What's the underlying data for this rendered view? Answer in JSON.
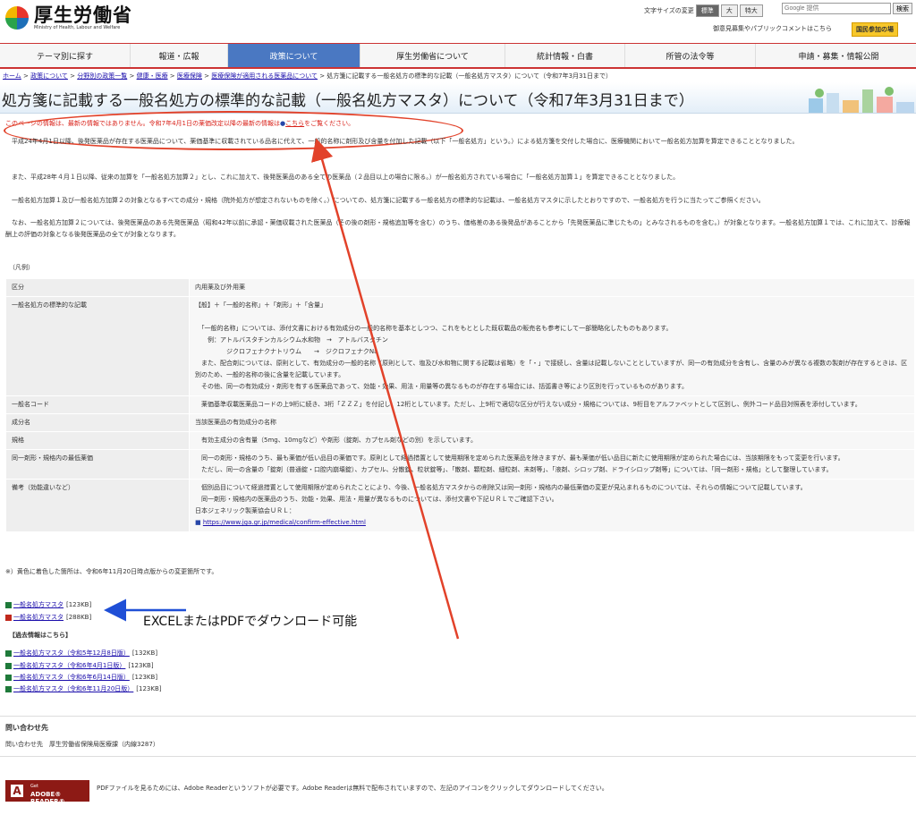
{
  "header": {
    "logo_jp": "厚生労働省",
    "logo_en": "Ministry of Health, Labour and Welfare",
    "fontsize_label": "文字サイズの変更",
    "fontsize_options": [
      "標準",
      "大",
      "特大"
    ],
    "search_placeholder": "Google 提供",
    "search_button": "検索",
    "pubcomment": "御意見募集やパブリックコメントはこちら",
    "kokumin": "国民参加の場"
  },
  "nav": [
    {
      "label": "テーマ別に探す",
      "active": false
    },
    {
      "label": "報道・広報",
      "active": false
    },
    {
      "label": "政策について",
      "active": true
    },
    {
      "label": "厚生労働省について",
      "active": false
    },
    {
      "label": "統計情報・白書",
      "active": false
    },
    {
      "label": "所管の法令等",
      "active": false
    },
    {
      "label": "申請・募集・情報公開",
      "active": false
    }
  ],
  "breadcrumb": {
    "links": [
      "ホーム",
      "政策について",
      "分野別の政策一覧",
      "健康・医療",
      "医療保険",
      "医療保険が適用される医薬品について"
    ],
    "sep": " > ",
    "current": "処方箋に記載する一般名処方の標準的な記載（一般名処方マスタ）について（令和7年3月31日まで）"
  },
  "title": "処方箋に記載する一般名処方の標準的な記載（一般名処方マスタ）について（令和7年3月31日まで）",
  "notice": {
    "text": "このページの情報は、最新の情報ではありません。令和7年4月1日の薬価改定以降の最新の情報は",
    "link": "こちら",
    "suffix": "をご覧ください。"
  },
  "paragraphs": [
    "　平成24年4月1日以降、後発医薬品が存在する医薬品について、薬価基準に収載されている品名に代えて、一般的名称に剤形及び含量を付加した記載（以下「一般名処方」という。）による処方箋を交付した場合に、医療機関において一般名処方加算を算定できることとなりました。",
    "　また、平成28年４月１日以降、従来の加算を「一般名処方加算２」とし、これに加えて、後発医薬品のある全ての医薬品（２品目以上の場合に限る。）が一般名処方されている場合に「一般名処方加算１」を算定できることとなりました。",
    "　一般名処方加算１及び一般名処方加算２の対象となるすべての成分・規格（院外処方が想定されないものを除く。）についての、処方箋に記載する一般名処方の標準的な記載は、一般名処方マスタに示したとおりですので、一般名処方を行うに当たってご参照ください。",
    "　なお、一般名処方加算２については、後発医薬品のある先発医薬品（昭和42年以前に承認・薬価収載された医薬品（その後の剤形・規格追加等を含む）のうち、価格差のある後発品があることから「先発医薬品に準じたもの」とみなされるものを含む。）が対象となります。一般名処方加算１では、これに加えて、診療報酬上の評価の対象となる後発医薬品の全てが対象となります。"
  ],
  "legend_label": "（凡例）",
  "legend": [
    {
      "key": "区分",
      "lines": [
        "内用薬及び外用薬"
      ]
    },
    {
      "key": "一般名処方の標準的な記載",
      "lines": [
        "【般】＋「一般的名称」＋「剤形」＋「含量」",
        "",
        "　「一般的名称」については、添付文書における有効成分の一般的名称を基本としつつ、これをもととした既収載品の販売名も参考にして一部簡略化したものもあります。",
        "　　例：アトルバスタチンカルシウム水和物　→　アトルバスタチン",
        "　　　　　ジクロフェナクナトリウム　　→　ジクロフェナクNa",
        "　また、配合剤については、原則として、有効成分の一般的名称（原則として、塩及び水和物に関する記載は省略）を「・」で接続し、含量は記載しないこととしていますが、同一の有効成分を含有し、含量のみが異なる複数の製剤が存在するときは、区別のため、一般的名称の後に含量を記載しています。",
        "　その他、同一の有効成分・剤形を有する医薬品であって、効能・効果、用法・用量等の異なるものが存在する場合には、括弧書き等により区別を行っているものがあります。"
      ]
    },
    {
      "key": "一般名コード",
      "lines": [
        "　薬価基準収載医薬品コードの上9桁に続き、3桁「ＺＺＺ」を付記し、12桁としています。ただし、上9桁で適切な区分が行えない成分・規格については、9桁目をアルファベットとして区別し、例外コード品目対照表を添付しています。"
      ]
    },
    {
      "key": "成分名",
      "lines": [
        "当該医薬品の有効成分の名称"
      ]
    },
    {
      "key": "規格",
      "lines": [
        "　有効主成分の含有量（5mg、10mgなど）や剤形（錠剤、カプセル剤などの別）を示しています。"
      ]
    },
    {
      "key": "同一剤形・規格内の最低薬価",
      "lines": [
        "　同一の剤形・規格のうち、最も薬価が低い品目の薬価です。原則として経過措置として使用期限を定められた医薬品を除きますが、最も薬価が低い品目に新たに使用期限が定められた場合には、当該期限をもって変更を行います。",
        "　ただし、同一の含量の「錠剤（普通錠・口腔内崩壊錠）、カプセル、分散錠、粒状錠等」、「散剤、顆粒剤、細粒剤、末剤等」、「液剤、シロップ剤、ドライシロップ剤等」については、「同一剤形・規格」として整理しています。"
      ]
    },
    {
      "key": "備考（効能違いなど）",
      "lines": [
        "　個別品目について経過措置として使用期限が定められたことにより、今後、一般名処方マスタからの削除又は同一剤形・規格内の最低薬価の変更が見込まれるものについては、それらの情報について記載しています。",
        "　同一剤形・規格内の医薬品のうち、効能・効果、用法・用量が異なるものについては、添付文書や下記ＵＲＬでご確認下さい。",
        "日本ジェネリック製薬協会ＵＲＬ："
      ],
      "url": "https://www.jga.gr.jp/medical/confirm-effective.html"
    }
  ],
  "yellow_note": "※）黄色に着色した箇所は、令和6年11月20日時点版からの変更箇所です。",
  "downloads": [
    {
      "label": "一般名処方マスタ",
      "size": "[123KB]",
      "type": "xls"
    },
    {
      "label": "一般名処方マスタ",
      "size": "[288KB]",
      "type": "pdf"
    }
  ],
  "annotation": "EXCELまたはPDFでダウンロード可能",
  "past_heading": "【過去情報はこちら】",
  "past": [
    {
      "label": "一般名処方マスタ（令和5年12月8日版）",
      "size": "[132KB]"
    },
    {
      "label": "一般名処方マスタ（令和6年4月1日版）",
      "size": "[123KB]"
    },
    {
      "label": "一般名処方マスタ（令和6年6月14日版）",
      "size": "[123KB]"
    },
    {
      "label": "一般名処方マスタ（令和6年11月20日版）",
      "size": "[123KB]"
    }
  ],
  "contact": {
    "heading": "問い合わせ先",
    "text": "問い合わせ先　厚生労働省保険局医療課（内線3287）"
  },
  "adobe": {
    "get": "Get",
    "reader": "ADOBE® READER®",
    "text": "PDFファイルを見るためには、Adobe Readerというソフトが必要です。Adobe Readerは無料で配布されていますので、左記のアイコンをクリックしてダウンロードしてください。"
  },
  "colors": {
    "annotation_red": "#e2422a",
    "annotation_blue": "#1f4fd6",
    "nav_active": "#4a78c2",
    "brand_red": "#cc3333"
  }
}
